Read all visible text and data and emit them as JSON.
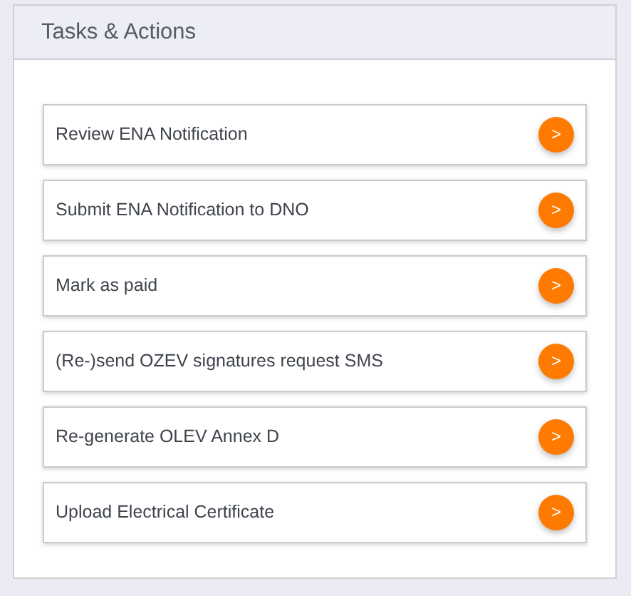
{
  "panel": {
    "title": "Tasks & Actions"
  },
  "tasks": [
    {
      "label": "Review ENA Notification",
      "button": ">"
    },
    {
      "label": "Submit ENA Notification to DNO",
      "button": ">"
    },
    {
      "label": "Mark as paid",
      "button": ">"
    },
    {
      "label": "(Re-)send OZEV signatures request SMS",
      "button": ">"
    },
    {
      "label": "Re-generate OLEV Annex D",
      "button": ">"
    },
    {
      "label": "Upload Electrical Certificate",
      "button": ">"
    }
  ]
}
